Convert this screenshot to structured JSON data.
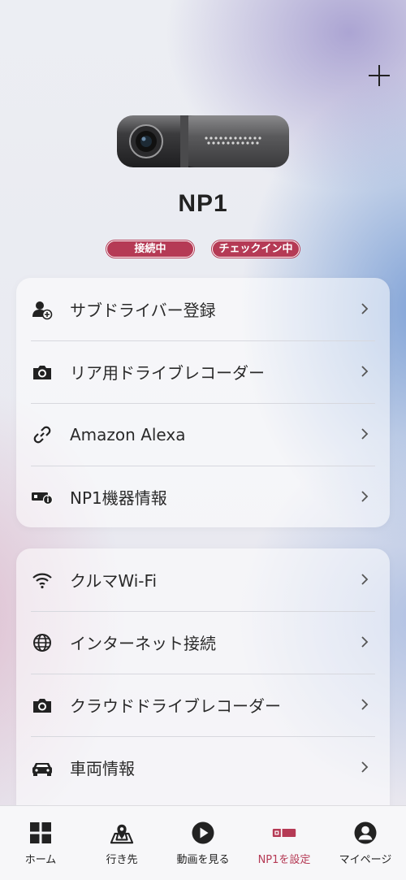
{
  "device": {
    "name": "NP1",
    "badges": [
      "接続中",
      "チェックイン中"
    ]
  },
  "header": {
    "add_icon": "plus-icon"
  },
  "section1": {
    "items": [
      {
        "label": "サブドライバー登録",
        "icon": "add-user-icon"
      },
      {
        "label": "リア用ドライブレコーダー",
        "icon": "camera-icon"
      },
      {
        "label": "Amazon Alexa",
        "icon": "link-icon"
      },
      {
        "label": "NP1機器情報",
        "icon": "device-info-icon"
      }
    ]
  },
  "section2": {
    "items": [
      {
        "label": "クルマWi-Fi",
        "icon": "wifi-icon"
      },
      {
        "label": "インターネット接続",
        "icon": "globe-icon"
      },
      {
        "label": "クラウドドライブレコーダー",
        "icon": "camera-icon"
      },
      {
        "label": "車両情報",
        "icon": "car-icon"
      }
    ]
  },
  "tabbar": {
    "tabs": [
      {
        "label": "ホーム",
        "icon": "grid-icon"
      },
      {
        "label": "行き先",
        "icon": "map-pin-icon"
      },
      {
        "label": "動画を見る",
        "icon": "play-icon"
      },
      {
        "label": "NP1を設定",
        "icon": "device-icon",
        "active": true
      },
      {
        "label": "マイページ",
        "icon": "user-icon"
      }
    ]
  },
  "colors": {
    "accent": "#b53a55",
    "text": "#222222"
  }
}
